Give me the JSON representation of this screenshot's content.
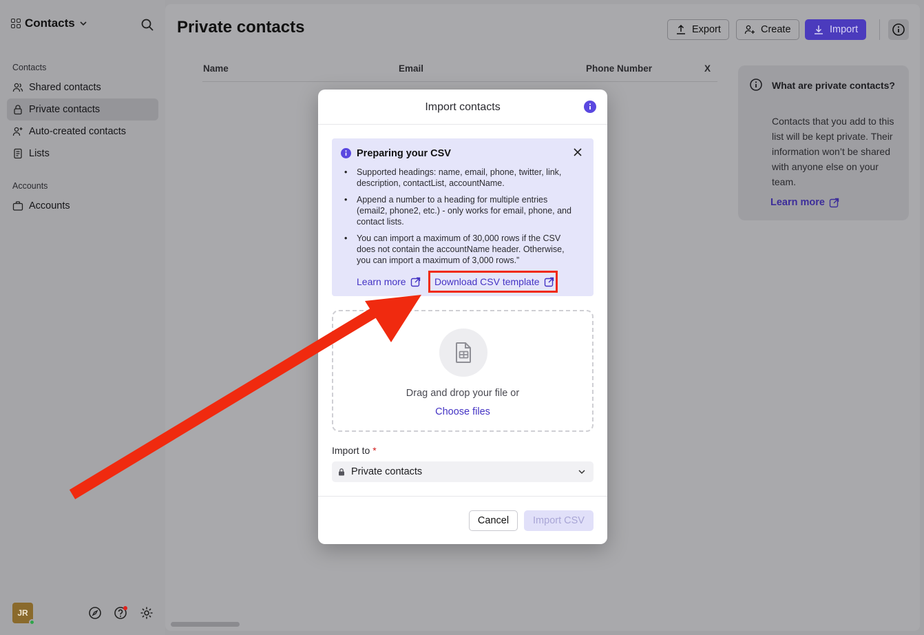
{
  "sidebar": {
    "app_name": "Contacts",
    "sections": [
      {
        "title": "Contacts"
      },
      {
        "title": "Accounts"
      }
    ],
    "items": [
      {
        "label": "Shared contacts",
        "icon": "users-icon"
      },
      {
        "label": "Private contacts",
        "icon": "lock-icon",
        "active": true
      },
      {
        "label": "Auto-created contacts",
        "icon": "user-sparkle-icon"
      },
      {
        "label": "Lists",
        "icon": "list-icon"
      },
      {
        "label": "Accounts",
        "icon": "briefcase-icon"
      }
    ],
    "avatar_initials": "JR"
  },
  "header": {
    "title": "Private contacts",
    "export_label": "Export",
    "create_label": "Create",
    "import_label": "Import"
  },
  "table": {
    "columns": [
      "Name",
      "Email",
      "Phone Number",
      "X"
    ]
  },
  "side_card": {
    "question": "What are private contacts?",
    "text": "Contacts that you add to this list will be kept private. Their information won’t be shared with anyone else on your team.",
    "learn_more": "Learn more"
  },
  "modal": {
    "title": "Import contacts",
    "csv_box": {
      "heading": "Preparing your CSV",
      "bullets": [
        "Supported headings: name, email, phone, twitter, link, description, contactList, accountName.",
        "Append a number to a heading for multiple entries (email2, phone2, etc.) - only works for email, phone, and contact lists.",
        "You can import a maximum of 30,000 rows if the CSV does not contain the accountName header. Otherwise, you can import a maximum of 3,000 rows.”"
      ],
      "learn_more": "Learn more",
      "download_template": "Download CSV template"
    },
    "drop_text": "Drag and drop your file or",
    "choose_files": "Choose files",
    "import_to_label": "Import to",
    "required_mark": "*",
    "import_to_value": "Private contacts",
    "cancel_label": "Cancel",
    "import_csv_label": "Import CSV"
  },
  "colors": {
    "accent": "#5a48e0",
    "annotation": "#f02a0f"
  }
}
